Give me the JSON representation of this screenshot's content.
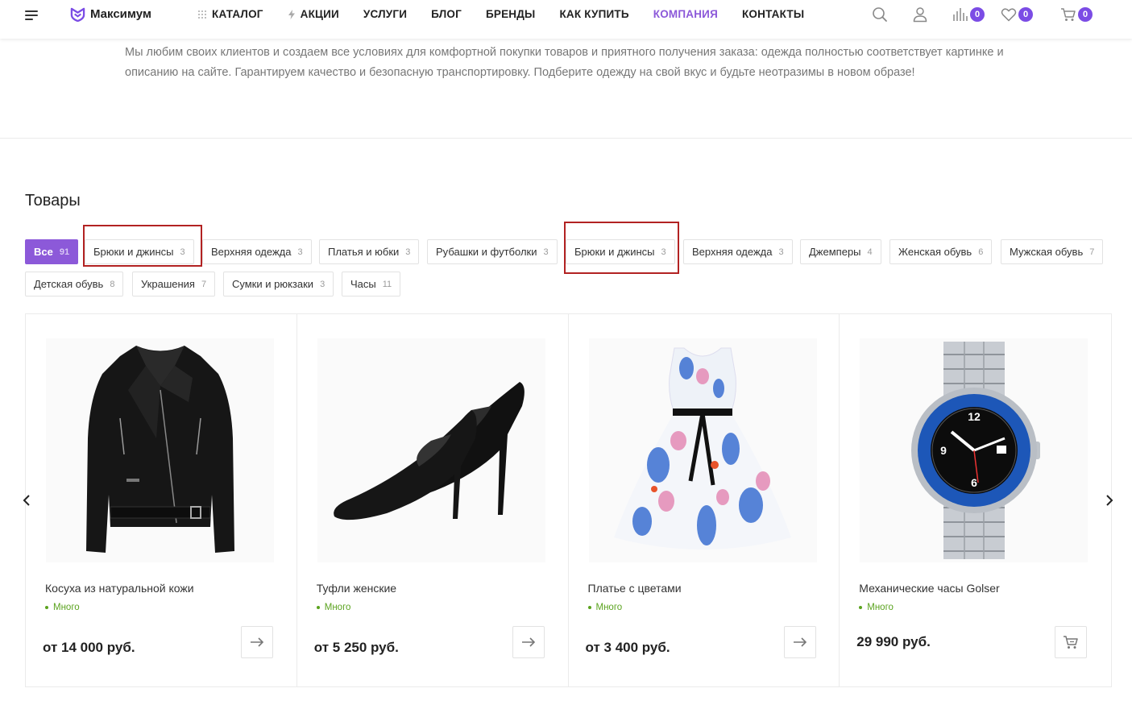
{
  "header": {
    "logo": "Максимум",
    "nav": [
      {
        "label": "КАТАЛОГ",
        "icon": "grid-icon"
      },
      {
        "label": "АКЦИИ",
        "icon": "lightning-icon"
      },
      {
        "label": "УСЛУГИ"
      },
      {
        "label": "БЛОГ"
      },
      {
        "label": "БРЕНДЫ"
      },
      {
        "label": "КАК КУПИТЬ"
      },
      {
        "label": "КОМПАНИЯ",
        "active": true
      },
      {
        "label": "КОНТАКТЫ"
      }
    ],
    "compare_count": "0",
    "favorites_count": "0",
    "cart_count": "0",
    "accent_color": "#8c59d9"
  },
  "intro_text": "Мы любим своих клиентов и создаем все условиях для комфортной покупки товаров и приятного получения заказа: одежда полностью соответствует картинке и описанию на сайте. Гарантируем качество и безопасную транспортировку. Подберите одежду на свой вкус и будьте неотразимы в новом образе!",
  "section_title": "Товары",
  "filters": [
    {
      "label": "Все",
      "count": "91",
      "active": true
    },
    {
      "label": "Брюки и джинсы",
      "count": "3",
      "highlighted": true
    },
    {
      "label": "Верхняя одежда",
      "count": "3"
    },
    {
      "label": "Платья и юбки",
      "count": "3"
    },
    {
      "label": "Рубашки и футболки",
      "count": "3"
    },
    {
      "label": "Брюки и джинсы",
      "count": "3",
      "highlighted": true
    },
    {
      "label": "Верхняя одежда",
      "count": "3"
    },
    {
      "label": "Джемперы",
      "count": "4"
    },
    {
      "label": "Женская обувь",
      "count": "6"
    },
    {
      "label": "Мужская обувь",
      "count": "7"
    },
    {
      "label": "Детская обувь",
      "count": "8"
    },
    {
      "label": "Украшения",
      "count": "7"
    },
    {
      "label": "Сумки и рюкзаки",
      "count": "3"
    },
    {
      "label": "Часы",
      "count": "11"
    }
  ],
  "products": [
    {
      "name": "Косуха из натуральной кожи",
      "stock": "Много",
      "price": "от 14 000 руб.",
      "image": "leather-jacket-image",
      "action": "arrow-right-icon"
    },
    {
      "name": "Туфли женские",
      "stock": "Много",
      "price": "от 5 250 руб.",
      "image": "pumps-image",
      "action": "arrow-right-icon"
    },
    {
      "name": "Платье с цветами",
      "stock": "Много",
      "price": "от 3 400 руб.",
      "image": "floral-dress-image",
      "action": "arrow-right-icon"
    },
    {
      "name": "Механические часы Golser",
      "stock": "Много",
      "price": "29 990 руб.",
      "image": "watch-image",
      "action": "cart-icon"
    }
  ]
}
